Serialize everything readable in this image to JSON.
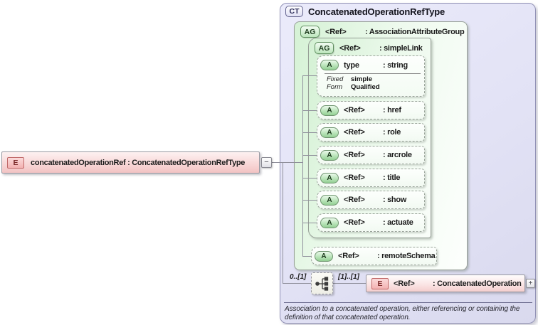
{
  "root_element": {
    "badge": "E",
    "label": "concatenatedOperationRef : ConcatenatedOperationRefType",
    "collapse_glyph": "−"
  },
  "type_panel": {
    "badge": "CT",
    "title": "ConcatenatedOperationRefType",
    "association_attribute_group": {
      "badge": "AG",
      "ref": "<Ref>",
      "type": ": AssociationAttributeGroup",
      "simple_link": {
        "badge": "AG",
        "ref": "<Ref>",
        "type": ": simpleLink",
        "type_attribute": {
          "badge": "A",
          "name": "type",
          "type": ": string",
          "facets": {
            "fixed_label": "Fixed",
            "fixed_value": "simple",
            "form_label": "Form",
            "form_value": "Qualified"
          }
        },
        "ref_attributes": [
          {
            "badge": "A",
            "ref": "<Ref>",
            "type": ": href"
          },
          {
            "badge": "A",
            "ref": "<Ref>",
            "type": ": role"
          },
          {
            "badge": "A",
            "ref": "<Ref>",
            "type": ": arcrole"
          },
          {
            "badge": "A",
            "ref": "<Ref>",
            "type": ": title"
          },
          {
            "badge": "A",
            "ref": "<Ref>",
            "type": ": show"
          },
          {
            "badge": "A",
            "ref": "<Ref>",
            "type": ": actuate"
          }
        ]
      },
      "remote_schema": {
        "badge": "A",
        "ref": "<Ref>",
        "type": ": remoteSchema"
      }
    },
    "content_row": {
      "occurrence_left": "0..[1]",
      "occurrence_right": "[1]..[1]",
      "child_element": {
        "badge": "E",
        "ref": "<Ref>",
        "type": ": ConcatenatedOperation",
        "expand_glyph": "+"
      }
    },
    "documentation": "Association to a concatenated operation, either referencing or containing the definition of that concatenated operation."
  }
}
